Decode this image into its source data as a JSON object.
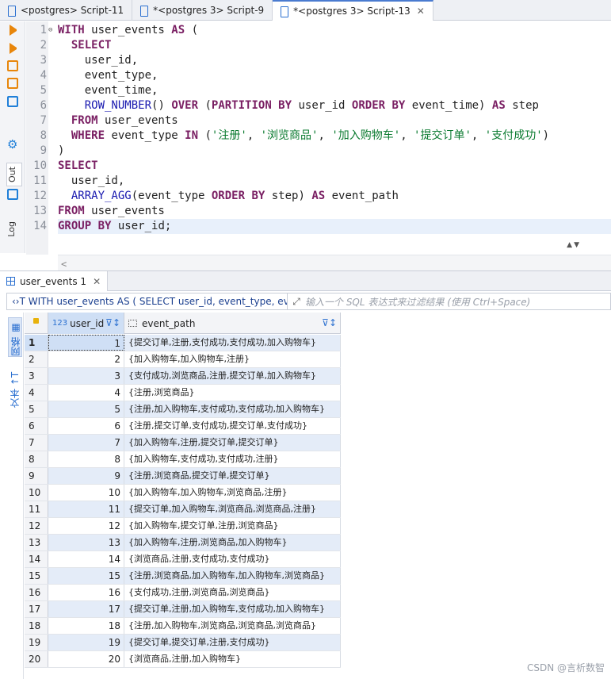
{
  "tabs": [
    {
      "label": "<postgres> Script-11",
      "active": false,
      "closable": false
    },
    {
      "label": "*<postgres 3> Script-9",
      "active": false,
      "closable": false
    },
    {
      "label": "*<postgres 3> Script-13",
      "active": true,
      "closable": true
    }
  ],
  "left_toolbar": {
    "out_label": "Out",
    "log_label": "Log"
  },
  "editor": {
    "line_numbers": [
      "1",
      "2",
      "3",
      "4",
      "5",
      "6",
      "7",
      "8",
      "9",
      "10",
      "11",
      "12",
      "13",
      "14"
    ],
    "current_line": 14
  },
  "result_tab": {
    "label": "user_events 1"
  },
  "filter": {
    "query_text": "WITH user_events AS ( SELECT user_id, event_type, event_",
    "placeholder": "输入一个 SQL 表达式来过滤结果 (使用 Ctrl+Space)"
  },
  "result_side": {
    "grid_label": "网格",
    "text_label": "文本"
  },
  "columns": [
    {
      "name": "user_id",
      "type_icon": "123"
    },
    {
      "name": "event_path",
      "type_icon": "text-icon"
    }
  ],
  "rows": [
    {
      "n": "1",
      "user_id": "1",
      "event_path": "{提交订单,注册,支付成功,支付成功,加入购物车}"
    },
    {
      "n": "2",
      "user_id": "2",
      "event_path": "{加入购物车,加入购物车,注册}"
    },
    {
      "n": "3",
      "user_id": "3",
      "event_path": "{支付成功,浏览商品,注册,提交订单,加入购物车}"
    },
    {
      "n": "4",
      "user_id": "4",
      "event_path": "{注册,浏览商品}"
    },
    {
      "n": "5",
      "user_id": "5",
      "event_path": "{注册,加入购物车,支付成功,支付成功,加入购物车}"
    },
    {
      "n": "6",
      "user_id": "6",
      "event_path": "{注册,提交订单,支付成功,提交订单,支付成功}"
    },
    {
      "n": "7",
      "user_id": "7",
      "event_path": "{加入购物车,注册,提交订单,提交订单}"
    },
    {
      "n": "8",
      "user_id": "8",
      "event_path": "{加入购物车,支付成功,支付成功,注册}"
    },
    {
      "n": "9",
      "user_id": "9",
      "event_path": "{注册,浏览商品,提交订单,提交订单}"
    },
    {
      "n": "10",
      "user_id": "10",
      "event_path": "{加入购物车,加入购物车,浏览商品,注册}"
    },
    {
      "n": "11",
      "user_id": "11",
      "event_path": "{提交订单,加入购物车,浏览商品,浏览商品,注册}"
    },
    {
      "n": "12",
      "user_id": "12",
      "event_path": "{加入购物车,提交订单,注册,浏览商品}"
    },
    {
      "n": "13",
      "user_id": "13",
      "event_path": "{加入购物车,注册,浏览商品,加入购物车}"
    },
    {
      "n": "14",
      "user_id": "14",
      "event_path": "{浏览商品,注册,支付成功,支付成功}"
    },
    {
      "n": "15",
      "user_id": "15",
      "event_path": "{注册,浏览商品,加入购物车,加入购物车,浏览商品}"
    },
    {
      "n": "16",
      "user_id": "16",
      "event_path": "{支付成功,注册,浏览商品,浏览商品}"
    },
    {
      "n": "17",
      "user_id": "17",
      "event_path": "{提交订单,注册,加入购物车,支付成功,加入购物车}"
    },
    {
      "n": "18",
      "user_id": "18",
      "event_path": "{注册,加入购物车,浏览商品,浏览商品,浏览商品}"
    },
    {
      "n": "19",
      "user_id": "19",
      "event_path": "{提交订单,提交订单,注册,支付成功}"
    },
    {
      "n": "20",
      "user_id": "20",
      "event_path": "{浏览商品,注册,加入购物车}"
    }
  ],
  "watermark": "CSDN @言析数智"
}
